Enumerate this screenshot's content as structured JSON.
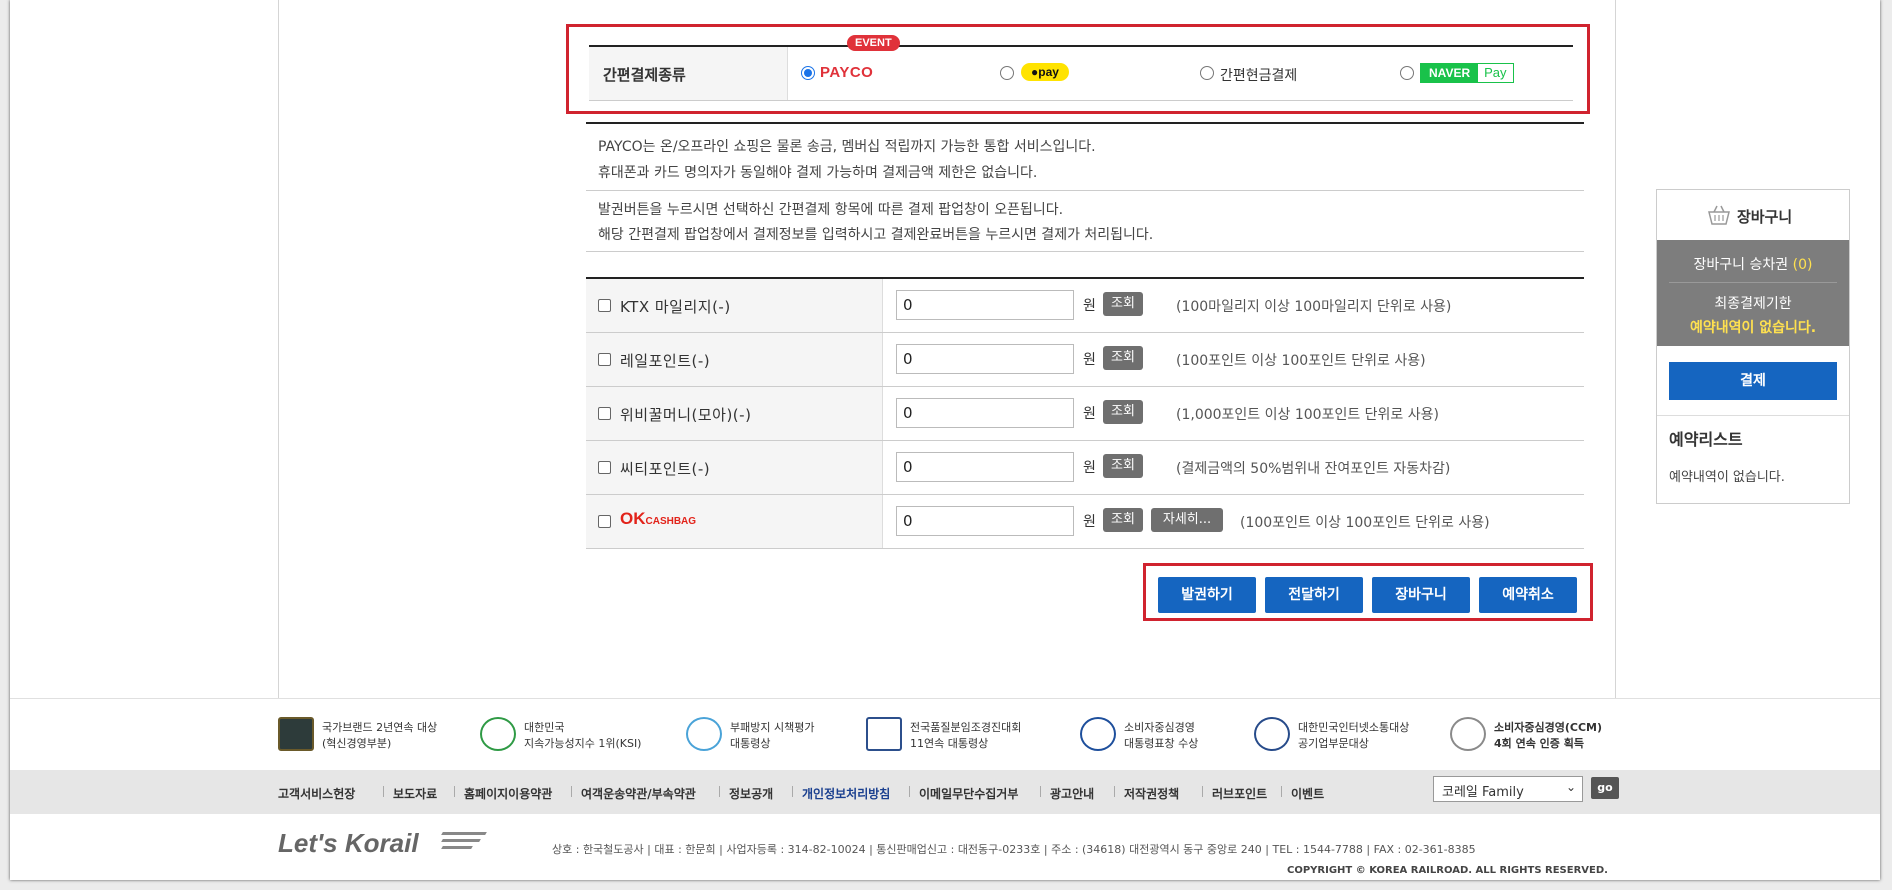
{
  "simple_pay": {
    "label": "간편결제종류",
    "payco": "PAYCO",
    "event": "EVENT",
    "kakao": "pay",
    "cash": "간편현금결제",
    "naver_n": "NAVER",
    "naver_pay": "Pay"
  },
  "info": {
    "line1": "PAYCO는 온/오프라인 쇼핑은 물론 송금, 멤버십 적립까지 가능한 통합 서비스입니다.",
    "line2": "휴대폰과 카드 명의자가 동일해야 결제 가능하며 결제금액 제한은 없습니다.",
    "line3": "발권버튼을 누르시면 선택하신 간편결제 항목에 따른 결제 팝업창이 오픈됩니다.",
    "line4": "해당 간편결제 팝업창에서 결제정보를 입력하시고 결제완료버튼을 누르시면 결제가 처리됩니다."
  },
  "points": {
    "won": "원",
    "lookup": "조회",
    "detail": "자세히...",
    "rows": [
      {
        "label": "KTX 마일리지(-)",
        "value": "0",
        "note": "(100마일리지 이상 100마일리지 단위로 사용)"
      },
      {
        "label": "레일포인트(-)",
        "value": "0",
        "note": "(100포인트 이상 100포인트 단위로 사용)"
      },
      {
        "label": "위비꿀머니(모아)(-)",
        "value": "0",
        "note": "(1,000포인트 이상 100포인트 단위로 사용)"
      },
      {
        "label": "씨티포인트(-)",
        "value": "0",
        "note": "(결제금액의 50%범위내 잔여포인트 자동차감)"
      },
      {
        "label": "OK CASHBAG",
        "value": "0",
        "note": "(100포인트 이상 100포인트 단위로 사용)",
        "ok": "OK",
        "cashbag": "CASHBAG"
      }
    ]
  },
  "actions": {
    "issue": "발권하기",
    "deliver": "전달하기",
    "cart": "장바구니",
    "cancel": "예약취소"
  },
  "cart": {
    "title": "장바구니",
    "count_label": "장바구니 승차권",
    "count": "(0)",
    "deadline_label": "최종결제기한",
    "no_reservation": "예약내역이 없습니다.",
    "pay": "결제",
    "list_title": "예약리스트",
    "list_empty": "예약내역이 없습니다."
  },
  "awards": [
    {
      "l1": "국가브랜드 2년연속 대상",
      "l2": "(혁신경영부분)"
    },
    {
      "l1": "대한민국",
      "l2": "지속가능성지수 1위(KSI)"
    },
    {
      "l1": "부패방지 시책평가",
      "l2": "대통령상"
    },
    {
      "l1": "전국품질분임조경진대회",
      "l2": "11연속 대통령상"
    },
    {
      "l1": "소비자중심경영",
      "l2": "대통령표창 수상"
    },
    {
      "l1": "대한민국인터넷소통대상",
      "l2": "공기업부문대상"
    },
    {
      "l1": "소비자중심경영(CCM)",
      "l2": "4회 연속 인증 획득"
    }
  ],
  "footer_links": [
    "고객서비스헌장",
    "보도자료",
    "홈페이지이용약관",
    "여객운송약관/부속약관",
    "정보공개",
    "개인정보처리방침",
    "이메일무단수집거부",
    "광고안내",
    "저작권정책",
    "러브포인트",
    "이벤트"
  ],
  "family_site": "코레일 Family",
  "go": "go",
  "logo": "Let's Korail",
  "company_info": "상호 : 한국철도공사  |  대표 : 한문희  |  사업자등록 : 314-82-10024  |  통신판매업신고 : 대전동구-0233호  |  주소 : (34618) 대전광역시 동구 중앙로 240  |  TEL : 1544-7788  |  FAX : 02-361-8385",
  "copyright": "COPYRIGHT © KOREA RAILROAD. ALL RIGHTS RESERVED."
}
